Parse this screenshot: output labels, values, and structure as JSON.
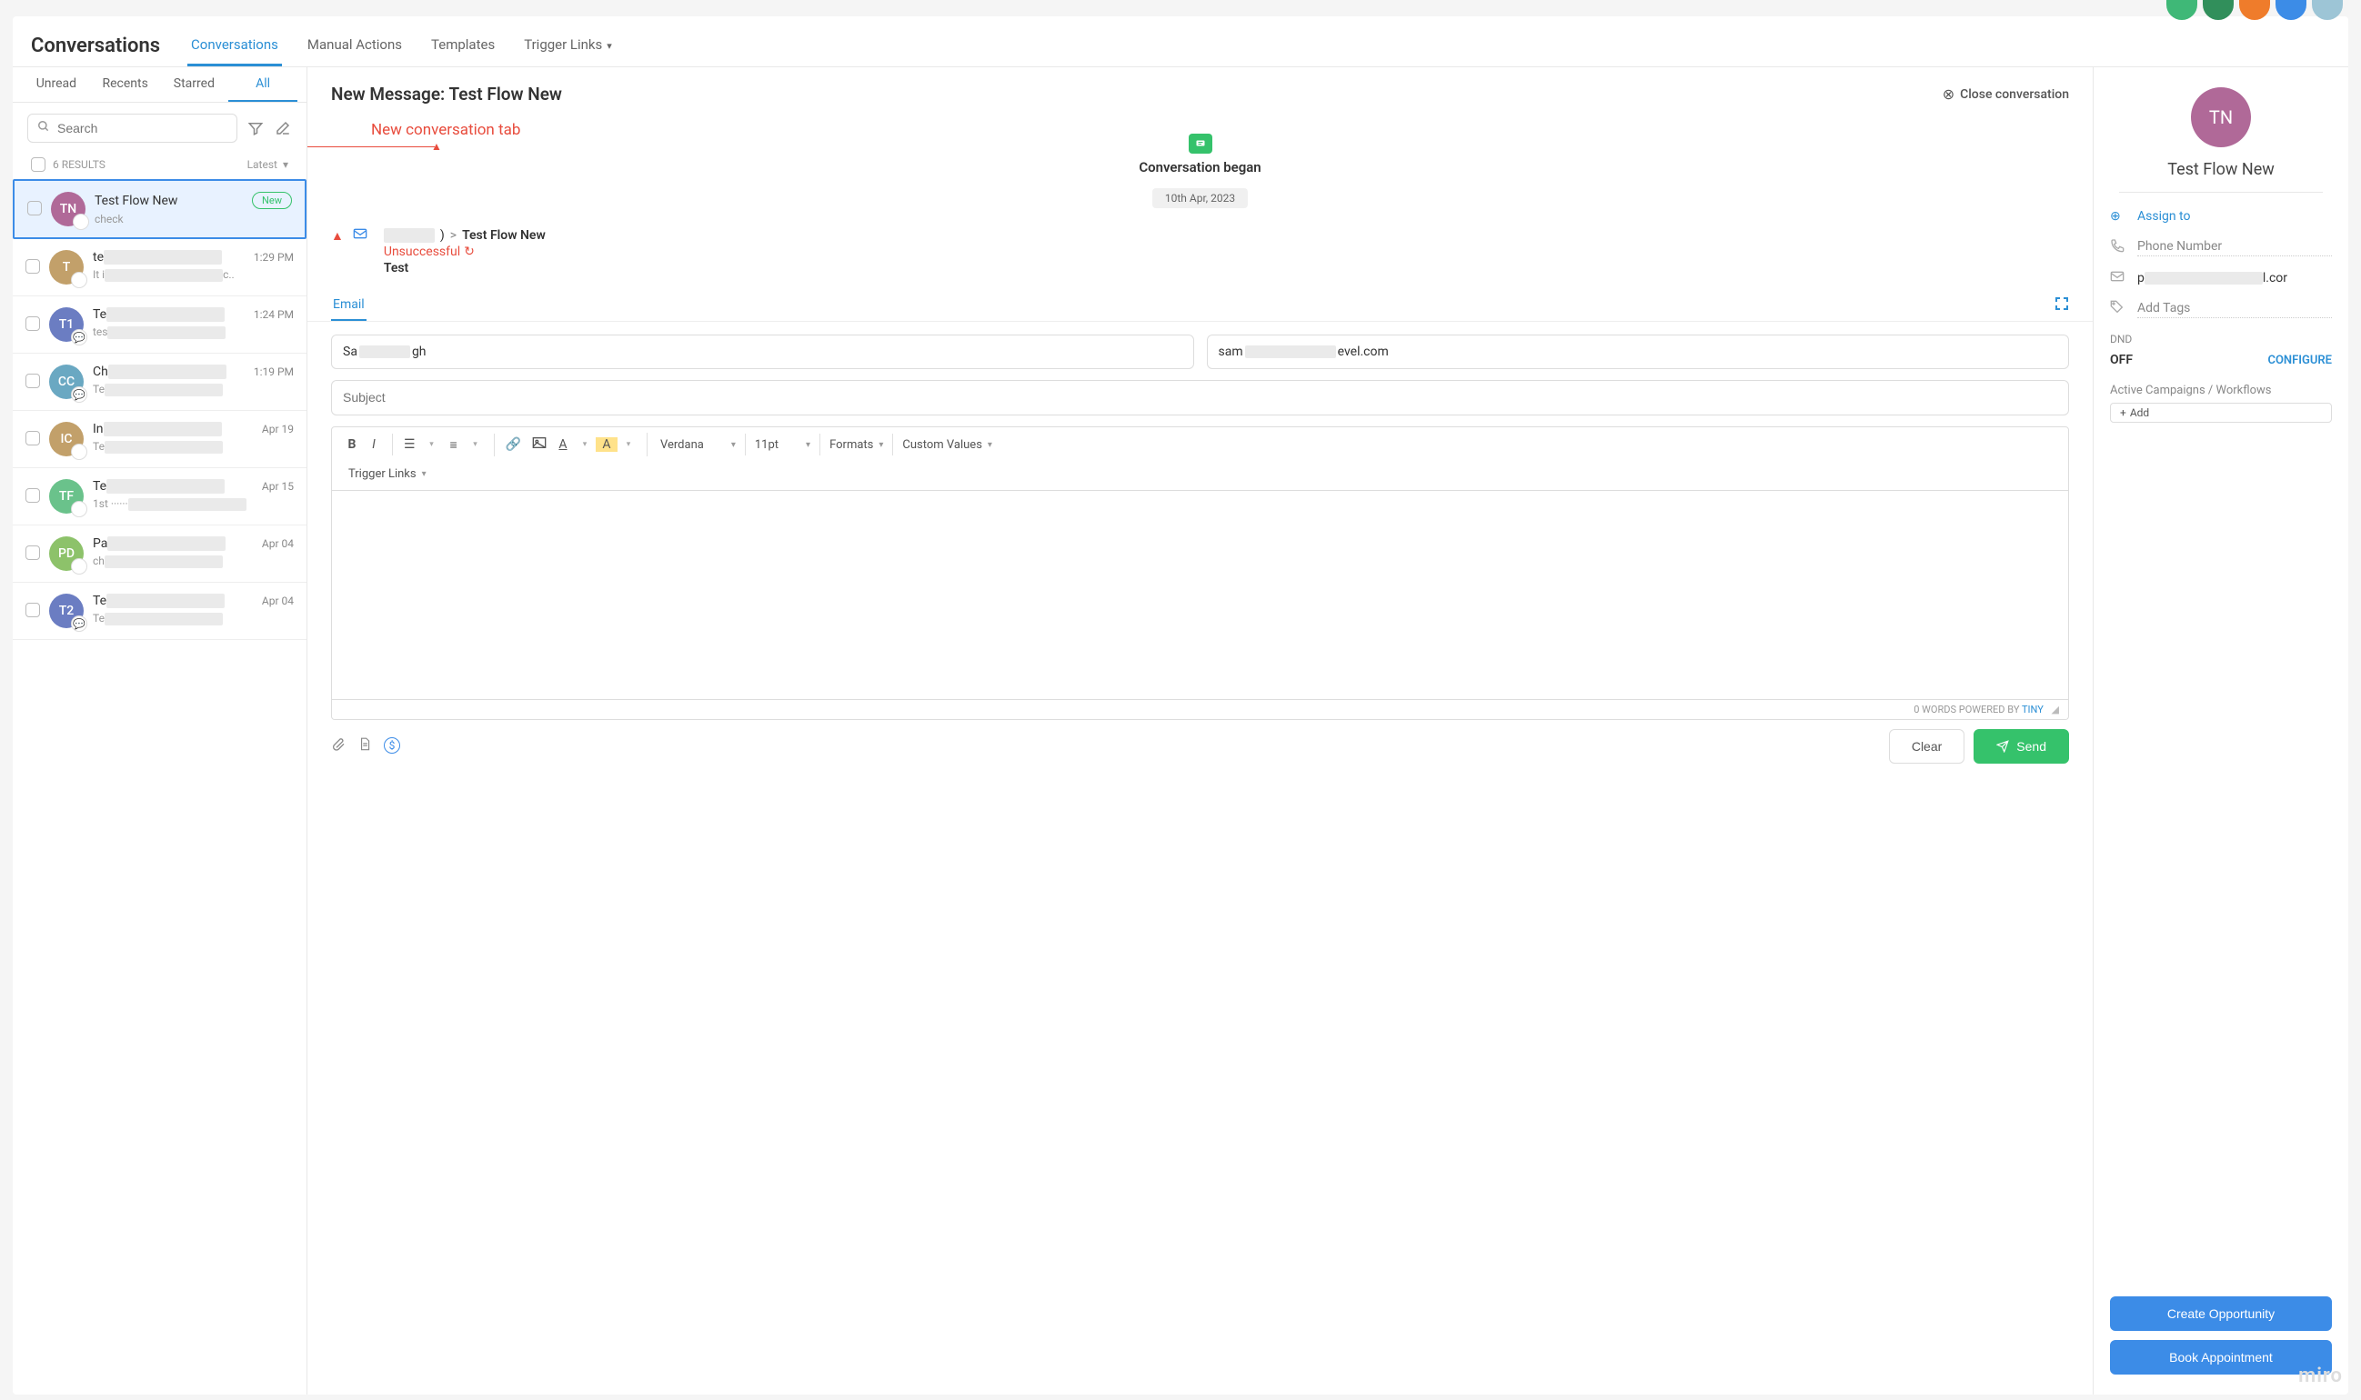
{
  "header": {
    "title": "Conversations",
    "tabs": [
      "Conversations",
      "Manual Actions",
      "Templates",
      "Trigger Links"
    ]
  },
  "subTabs": [
    "Unread",
    "Recents",
    "Starred",
    "All"
  ],
  "search": {
    "placeholder": "Search"
  },
  "results": {
    "count": "6 RESULTS",
    "sort": "Latest"
  },
  "annotation": "New conversation tab",
  "list": [
    {
      "initials": "TN",
      "color": "#b06998",
      "name": "Test Flow New",
      "preview": "check",
      "time": "",
      "new": true,
      "badge": "@"
    },
    {
      "initials": "T",
      "color": "#c2a06a",
      "name": "te",
      "preview": "It i",
      "previewTail": "c..",
      "time": "1:29 PM",
      "badge": "@"
    },
    {
      "initials": "T1",
      "color": "#6b7dc2",
      "name": "Te",
      "preview": "tes",
      "time": "1:24 PM",
      "badge": "💬"
    },
    {
      "initials": "CC",
      "color": "#6aa8c2",
      "name": "Ch",
      "preview": "Te",
      "time": "1:19 PM",
      "badge": "💬"
    },
    {
      "initials": "IC",
      "color": "#c2a06a",
      "name": "In",
      "preview": "Te",
      "time": "Apr 19",
      "badge": "@"
    },
    {
      "initials": "TF",
      "color": "#6ac28b",
      "name": "Te",
      "preview": "1st ······",
      "time": "Apr 15",
      "badge": "@"
    },
    {
      "initials": "PD",
      "color": "#8dc26a",
      "name": "Pa",
      "preview": "ch",
      "time": "Apr 04",
      "badge": "@"
    },
    {
      "initials": "T2",
      "color": "#6b7dc2",
      "name": "Te",
      "preview": "Te",
      "time": "Apr 04",
      "badge": "💬"
    }
  ],
  "message": {
    "title": "New Message: Test Flow New",
    "close": "Close conversation",
    "began": "Conversation began",
    "date": "10th Apr, 2023",
    "recipient": "Test Flow New",
    "separator": ">",
    "unsuccessful": "Unsuccessful",
    "subject": "Test"
  },
  "compose": {
    "tab": "Email",
    "from": "Sa",
    "fromTail": "gh",
    "to": "sam",
    "toTail": "evel.com",
    "subjectPlaceholder": "Subject",
    "font": "Verdana",
    "size": "11pt",
    "formats": "Formats",
    "customValues": "Custom Values",
    "triggerLinks": "Trigger Links",
    "wordCount": "0 WORDS POWERED BY ",
    "tiny": "TINY",
    "clear": "Clear",
    "send": "Send"
  },
  "contact": {
    "initials": "TN",
    "name": "Test Flow New",
    "assignTo": "Assign to",
    "phonePlaceholder": "Phone Number",
    "emailPrefix": "p",
    "emailTail": "l.cor",
    "tagsPlaceholder": "Add Tags",
    "dndLabel": "DND",
    "dndValue": "OFF",
    "configure": "CONFIGURE",
    "campaigns": "Active Campaigns / Workflows",
    "add": "Add",
    "createOpp": "Create Opportunity",
    "bookAppt": "Book Appointment"
  },
  "topAvatarColors": [
    "#3fb877",
    "#318f5b",
    "#ef7c2b",
    "#3c8ce7",
    "#9dc5d6"
  ]
}
